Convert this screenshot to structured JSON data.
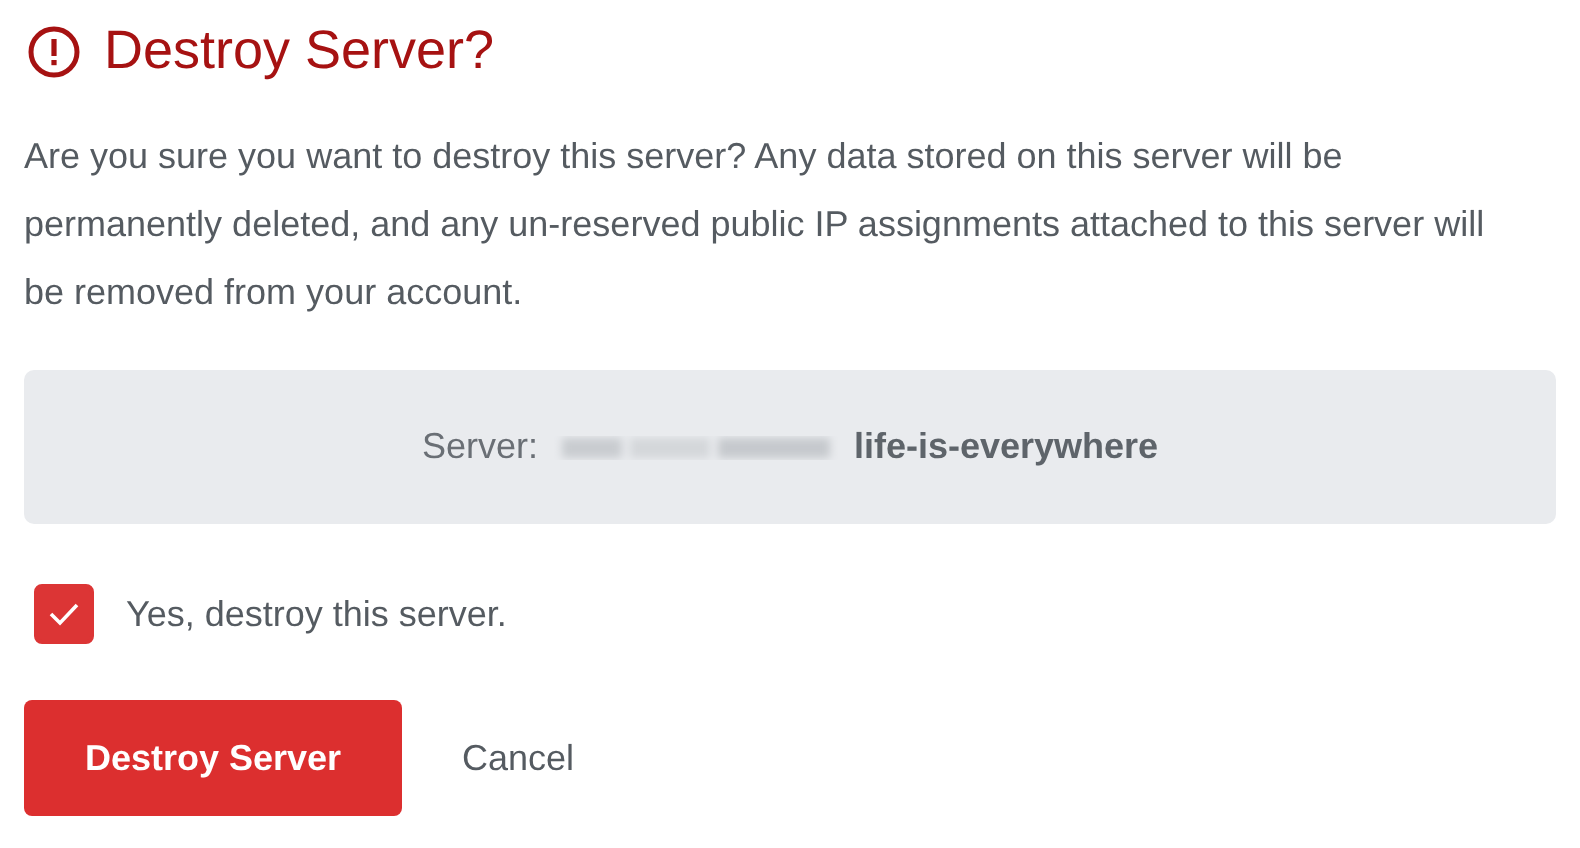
{
  "dialog": {
    "title": "Destroy Server?",
    "message": "Are you sure you want to destroy this server? Any data stored on this server will be permanently deleted, and any un-reserved public IP assignments attached to this server will be removed from your account.",
    "server": {
      "label": "Server:",
      "name": "life-is-everywhere"
    },
    "confirm": {
      "label": "Yes, destroy this server.",
      "checked": true
    },
    "buttons": [
      {
        "label": "Destroy Server",
        "kind": "primary"
      },
      {
        "label": "Cancel",
        "kind": "link"
      }
    ]
  }
}
